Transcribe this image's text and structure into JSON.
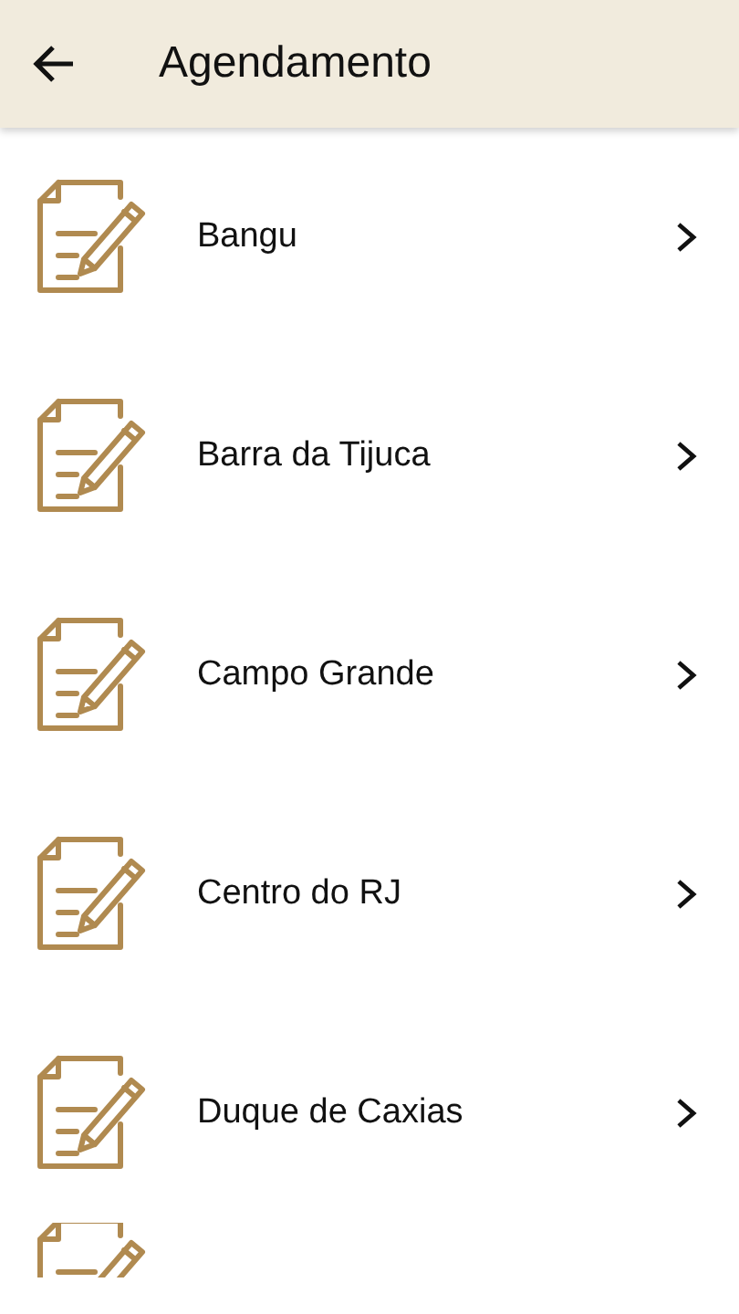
{
  "header": {
    "title": "Agendamento"
  },
  "items": [
    {
      "kind": "entry",
      "label": "Bangu"
    },
    {
      "kind": "entry",
      "label": "Barra da Tijuca"
    },
    {
      "kind": "entry",
      "label": "Campo Grande"
    },
    {
      "kind": "entry",
      "label": "Centro do RJ"
    },
    {
      "kind": "entry",
      "label": "Duque de Caxias"
    },
    {
      "kind": "partial"
    }
  ]
}
